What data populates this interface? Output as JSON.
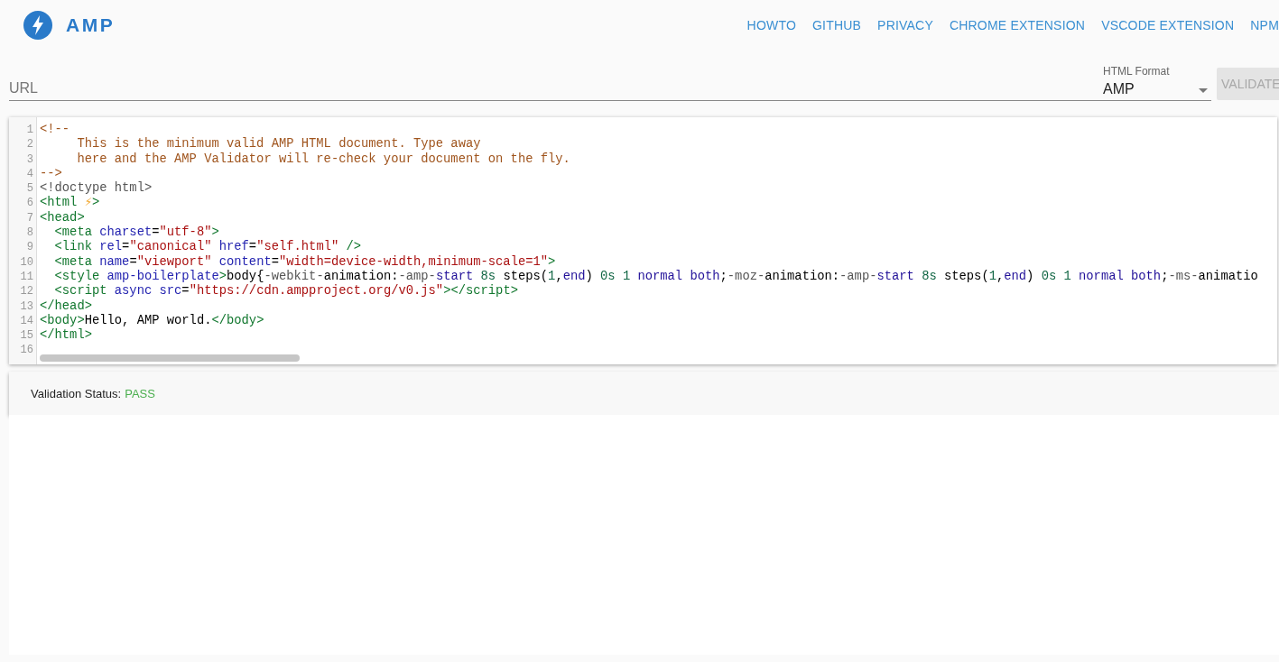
{
  "header": {
    "logo_text": "AMP",
    "nav": [
      "HOWTO",
      "GITHUB",
      "PRIVACY",
      "CHROME EXTENSION",
      "VSCODE EXTENSION",
      "NPM"
    ]
  },
  "form": {
    "url_placeholder": "URL",
    "format_label": "HTML Format",
    "format_value": "AMP",
    "validate_button": {
      "label": "VALIDATE",
      "disabled": true
    }
  },
  "editor": {
    "lines": [
      {
        "n": "1",
        "text": "<!--"
      },
      {
        "n": "2",
        "text": "     This is the minimum valid AMP HTML document. Type away"
      },
      {
        "n": "3",
        "text": "     here and the AMP Validator will re-check your document on the fly."
      },
      {
        "n": "4",
        "text": "-->"
      },
      {
        "n": "5",
        "text": "<!doctype html>"
      },
      {
        "n": "6",
        "text": "<html ⚡>"
      },
      {
        "n": "7",
        "text": "<head>"
      },
      {
        "n": "8",
        "text": "  <meta charset=\"utf-8\">"
      },
      {
        "n": "9",
        "text": "  <link rel=\"canonical\" href=\"self.html\" />"
      },
      {
        "n": "10",
        "text": "  <meta name=\"viewport\" content=\"width=device-width,minimum-scale=1\">"
      },
      {
        "n": "11",
        "text": "  <style amp-boilerplate>body{-webkit-animation:-amp-start 8s steps(1,end) 0s 1 normal both;-moz-animation:-amp-start 8s steps(1,end) 0s 1 normal both;-ms-animatio"
      },
      {
        "n": "12",
        "text": "  <script async src=\"https://cdn.ampproject.org/v0.js\"></script>"
      },
      {
        "n": "13",
        "text": "</head>"
      },
      {
        "n": "14",
        "text": "<body>Hello, AMP world.</body>"
      },
      {
        "n": "15",
        "text": "</html>"
      },
      {
        "n": "16"
      }
    ]
  },
  "status": {
    "label": "Validation Status:",
    "value": "PASS",
    "kind": "pass"
  }
}
